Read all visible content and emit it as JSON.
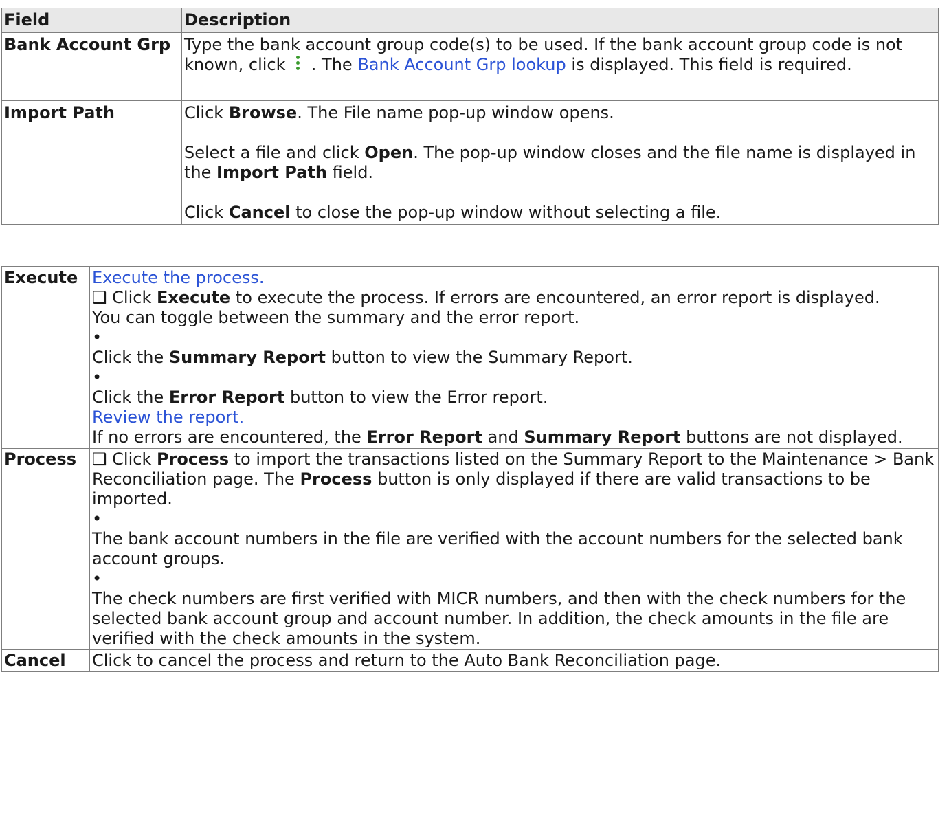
{
  "table1": {
    "headers": {
      "field": "Field",
      "description": "Description"
    },
    "bank_account_grp": {
      "field": "Bank Account Grp",
      "text_a": "Type the bank account group code(s) to be used. If the bank account group code is not known, click",
      "icon": "kebab-lookup-icon",
      "text_b": ". The",
      "link": "Bank Account Grp lookup",
      "text_c": "is displayed. This field is required."
    },
    "import_path": {
      "field": "Import Path",
      "p1_a": "Click",
      "p1_bold": "Browse",
      "p1_b": ". The File name pop-up window opens.",
      "p2_a": "Select a file and click",
      "p2_bold": "Open",
      "p2_b": ". The pop-up window closes and the file name is displayed in the",
      "p2_bold2": "Import Path",
      "p2_c": "field.",
      "p3_a": "Click",
      "p3_bold": "Cancel",
      "p3_b": "to close the pop-up window without selecting a file."
    }
  },
  "table2": {
    "execute": {
      "field": "Execute",
      "link1": "Execute the process.",
      "checkbox": "❑",
      "l2_a": "Click",
      "l2_bold": "Execute",
      "l2_b": "to execute the process. If errors are encountered, an error report is displayed.",
      "l3": "You can toggle between the summary and the error report.",
      "bullet": "•",
      "l4_a": "Click the",
      "l4_bold": "Summary Report",
      "l4_b": "button to view the Summary Report.",
      "l5_a": "Click the",
      "l5_bold": "Error Report",
      "l5_b": "button to view the Error report.",
      "link2": "Review the report.",
      "l6_a": "If no errors are encountered, the",
      "l6_bold": "Error Report",
      "l6_and": "and",
      "l6_bold2": "Summary Report",
      "l6_b": "buttons are not displayed."
    },
    "process": {
      "field": "Process",
      "checkbox": "❑",
      "l1_a": "Click",
      "l1_bold": "Process",
      "l1_b": "to import the transactions listed on the Summary Report to the Maintenance > Bank Reconciliation page. The",
      "l1_bold2": "Process",
      "l1_c": "button is only displayed if there are valid transactions to be imported.",
      "bullet": "•",
      "l2": "The bank account numbers in the file are verified with the account numbers for the selected bank account groups.",
      "l3": "The check numbers are first verified with MICR numbers, and then with the check numbers for the selected bank account group and account number. In addition, the check amounts in the file are verified with the check amounts in the system."
    },
    "cancel": {
      "field": "Cancel",
      "text": "Click to cancel the process and return to the Auto Bank Reconciliation page."
    }
  },
  "colors": {
    "link": "#2b53d6",
    "header_bg": "#e8e8e8",
    "border": "#7f7f7f",
    "icon": "#3a9a2d"
  }
}
